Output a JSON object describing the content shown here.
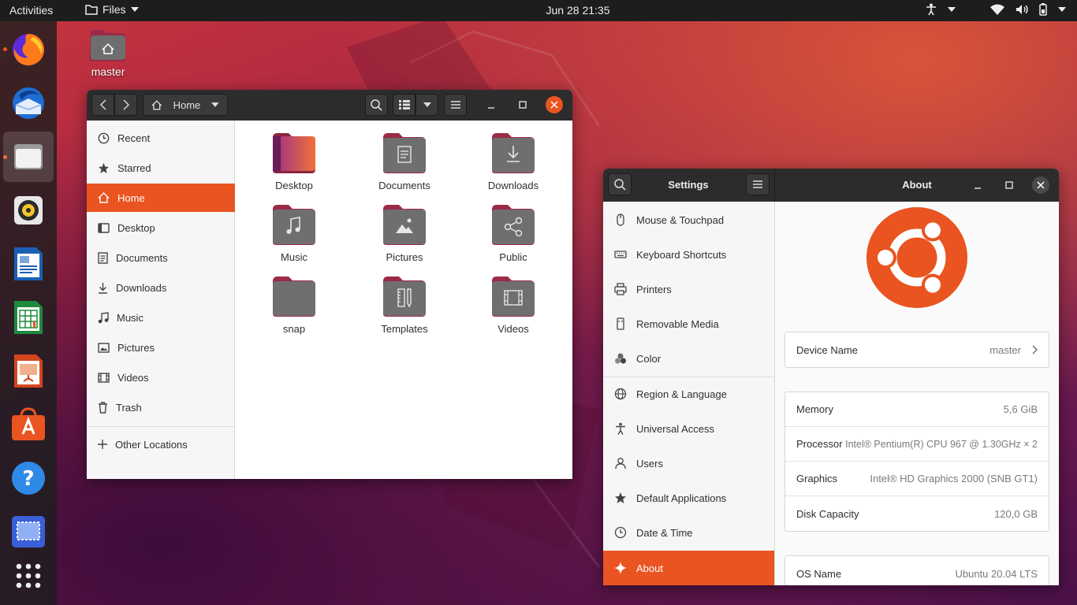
{
  "topbar": {
    "activities": "Activities",
    "app_menu": "Files",
    "clock": "Jun 28  21:35"
  },
  "desktop": {
    "home_icon_label": "master"
  },
  "files": {
    "location": "Home",
    "sidebar": [
      {
        "label": "Recent",
        "icon": "clock-icon"
      },
      {
        "label": "Starred",
        "icon": "star-icon"
      },
      {
        "label": "Home",
        "icon": "home-icon",
        "selected": true
      },
      {
        "label": "Desktop",
        "icon": "desktop-icon"
      },
      {
        "label": "Documents",
        "icon": "document-icon"
      },
      {
        "label": "Downloads",
        "icon": "download-icon"
      },
      {
        "label": "Music",
        "icon": "music-icon"
      },
      {
        "label": "Pictures",
        "icon": "picture-icon"
      },
      {
        "label": "Videos",
        "icon": "film-icon"
      },
      {
        "label": "Trash",
        "icon": "trash-icon"
      }
    ],
    "other_locations": "Other Locations",
    "folders": [
      {
        "label": "Desktop",
        "icon": "desktop-folder-icon"
      },
      {
        "label": "Documents",
        "icon": "documents-folder-icon"
      },
      {
        "label": "Downloads",
        "icon": "downloads-folder-icon"
      },
      {
        "label": "Music",
        "icon": "music-folder-icon"
      },
      {
        "label": "Pictures",
        "icon": "pictures-folder-icon"
      },
      {
        "label": "Public",
        "icon": "public-folder-icon"
      },
      {
        "label": "snap",
        "icon": "snap-folder-icon"
      },
      {
        "label": "Templates",
        "icon": "templates-folder-icon"
      },
      {
        "label": "Videos",
        "icon": "videos-folder-icon"
      }
    ]
  },
  "settings": {
    "sidebar_title": "Settings",
    "panel_title": "About",
    "items": [
      {
        "label": "Mouse & Touchpad",
        "icon": "mouse-icon"
      },
      {
        "label": "Keyboard Shortcuts",
        "icon": "keyboard-icon"
      },
      {
        "label": "Printers",
        "icon": "printer-icon"
      },
      {
        "label": "Removable Media",
        "icon": "removable-media-icon"
      },
      {
        "label": "Color",
        "icon": "color-icon"
      },
      {
        "label": "Region & Language",
        "icon": "globe-icon"
      },
      {
        "label": "Universal Access",
        "icon": "accessibility-icon"
      },
      {
        "label": "Users",
        "icon": "user-icon"
      },
      {
        "label": "Default Applications",
        "icon": "star-icon"
      },
      {
        "label": "Date & Time",
        "icon": "clock-icon"
      },
      {
        "label": "About",
        "icon": "sparkle-icon",
        "selected": true
      }
    ],
    "about": {
      "device_name_label": "Device Name",
      "device_name_value": "master",
      "hardware": [
        {
          "k": "Memory",
          "v": "5,6 GiB"
        },
        {
          "k": "Processor",
          "v": "Intel® Pentium(R) CPU 967 @ 1.30GHz × 2"
        },
        {
          "k": "Graphics",
          "v": "Intel® HD Graphics 2000 (SNB GT1)"
        },
        {
          "k": "Disk Capacity",
          "v": "120,0 GB"
        }
      ],
      "os_name_label": "OS Name",
      "os_name_value": "Ubuntu 20.04 LTS"
    }
  },
  "colors": {
    "accent": "#e95420",
    "headerbar": "#2c2c2c",
    "topbar": "#1d1d1d"
  }
}
